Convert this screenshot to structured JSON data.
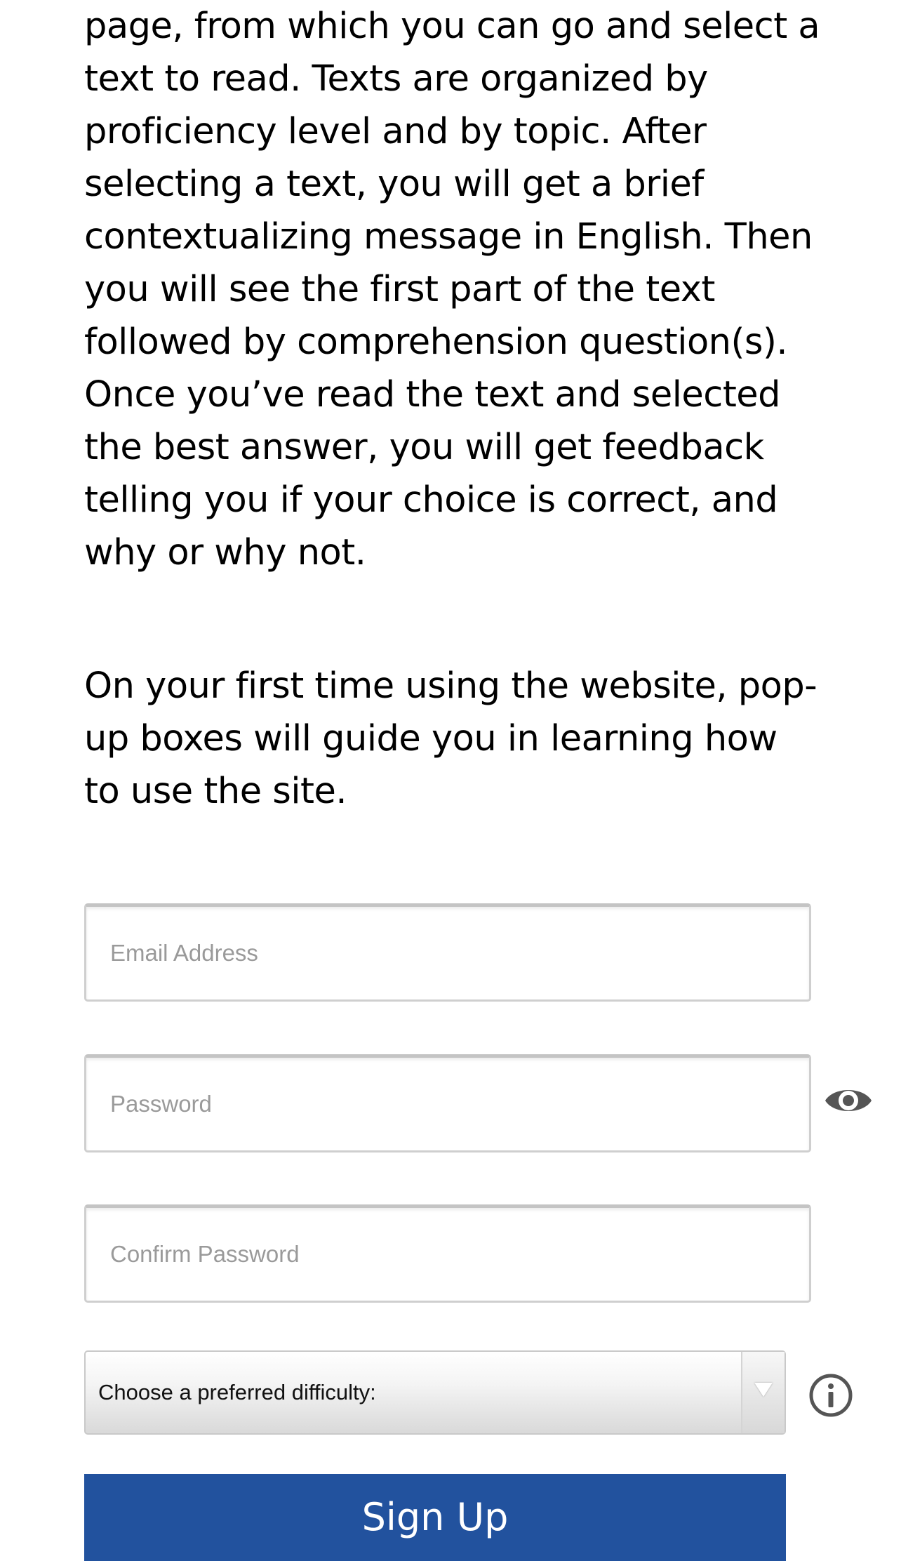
{
  "intro": {
    "paragraph1_lines": [
      "page, from which you can go and select a",
      "text to read. Texts are organized by",
      "proficiency level and by topic. After",
      "selecting a text, you will get a brief",
      "contextualizing message in English. Then",
      "you will see the first part of the text",
      "followed by comprehension question(s).",
      "Once you’ve read the text and selected",
      "the best answer, you will get feedback",
      "telling you if your choice is correct, and",
      "why or why not."
    ],
    "paragraph2_lines": [
      "On your first time using the website, pop-",
      "up boxes will guide you in learning how",
      "to use the site."
    ]
  },
  "form": {
    "email_placeholder": "Email Address",
    "password_placeholder": "Password",
    "confirm_password_placeholder": "Confirm Password",
    "difficulty_label": "Choose a preferred difficulty:",
    "signup_label": "Sign Up",
    "show_password_icon": "eye-icon",
    "difficulty_info_icon": "info-icon"
  },
  "colors": {
    "signup_button": "#22529e",
    "icon_gray": "#555555"
  }
}
